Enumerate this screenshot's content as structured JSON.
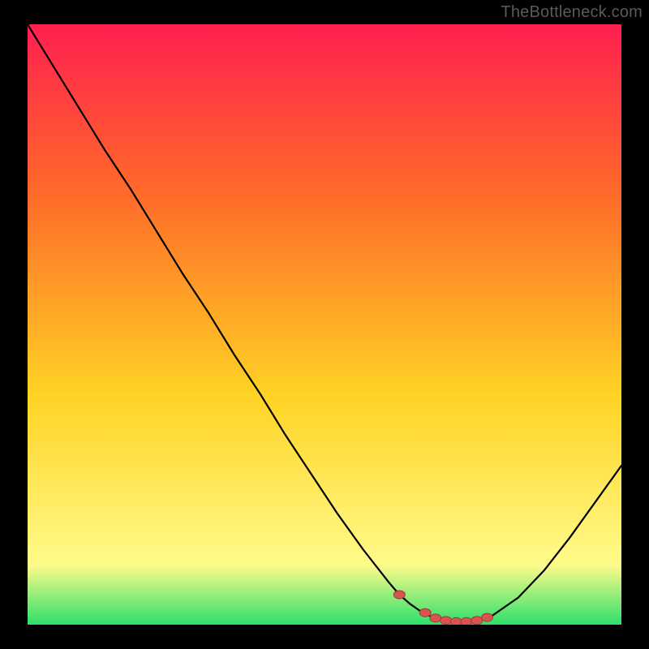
{
  "watermark": "TheBottleneck.com",
  "colors": {
    "frame": "#000000",
    "watermark_text": "#5a5a5a",
    "grad_top": "#ff1f4f",
    "grad_mid1": "#ff6a2a",
    "grad_mid2": "#ffd324",
    "grad_mid3": "#fffb8a",
    "grad_bottom": "#2de06a",
    "curve": "#000000",
    "marker_fill": "#d9534f",
    "marker_stroke": "#a03b38"
  },
  "chart_data": {
    "type": "line",
    "title": "",
    "xlabel": "",
    "ylabel": "",
    "xlim": [
      0,
      115
    ],
    "ylim": [
      0,
      100
    ],
    "x": [
      0,
      5,
      10,
      15,
      20,
      25,
      30,
      35,
      40,
      45,
      50,
      55,
      60,
      65,
      70,
      72,
      74,
      76,
      78,
      80,
      82,
      84,
      86,
      88,
      90,
      95,
      100,
      105,
      110,
      115
    ],
    "y": [
      100,
      93.0,
      86.0,
      79.0,
      72.5,
      65.5,
      58.5,
      52.0,
      45.0,
      38.5,
      31.5,
      25.0,
      18.5,
      12.5,
      7.0,
      5.0,
      3.5,
      2.3,
      1.4,
      0.9,
      0.6,
      0.4,
      0.5,
      0.8,
      1.5,
      4.5,
      9.0,
      14.5,
      20.5,
      26.5
    ],
    "markers_x": [
      72,
      77,
      79,
      81,
      83,
      85,
      87,
      89
    ],
    "markers_y": [
      5.0,
      2.0,
      1.1,
      0.7,
      0.5,
      0.5,
      0.7,
      1.2
    ]
  }
}
